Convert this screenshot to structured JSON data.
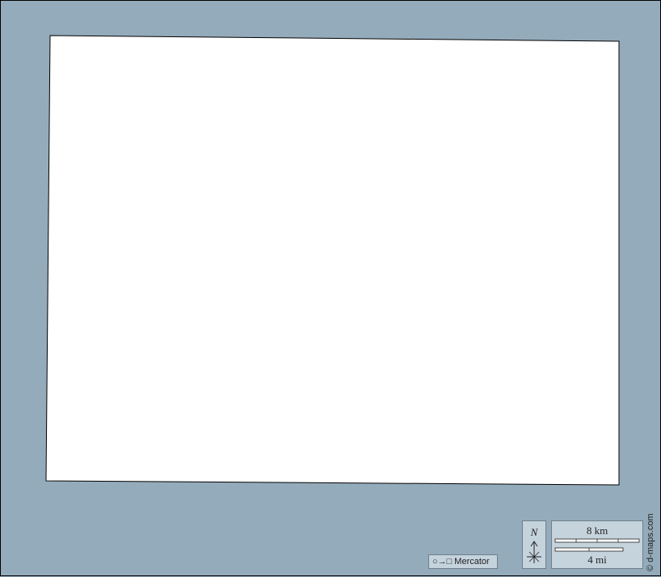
{
  "map": {
    "background_color": "#94abbb",
    "land_color": "#ffffff",
    "border_color": "#000000"
  },
  "legend": {
    "projection_icons": "○→□",
    "projection_label": "Mercator",
    "north_label": "N",
    "scale_km_label": "8 km",
    "scale_mi_label": "4 mi"
  },
  "credit": "© d-maps.com"
}
